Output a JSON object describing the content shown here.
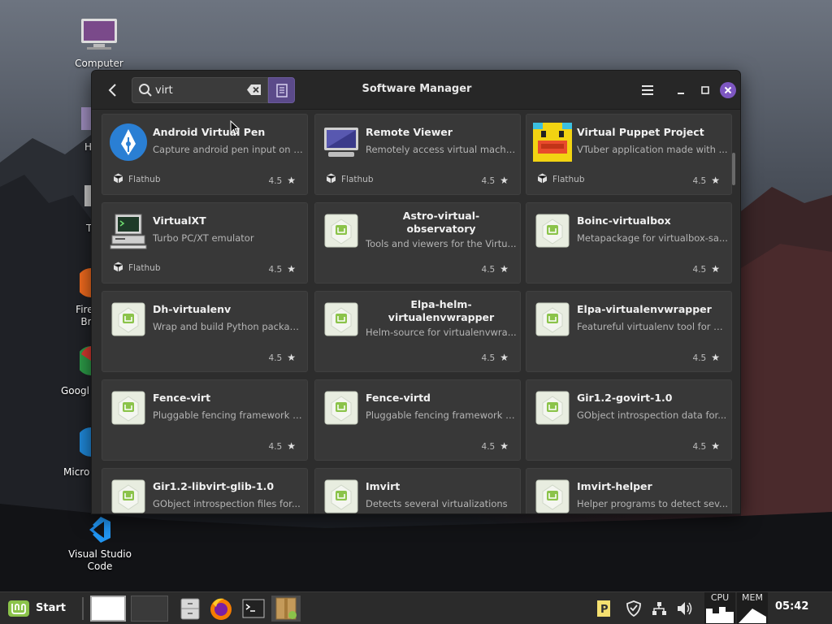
{
  "desktop": {
    "icons": [
      {
        "label": "Computer"
      },
      {
        "label": "H"
      },
      {
        "label": "T"
      },
      {
        "label": "Firef\nBr"
      },
      {
        "label": "Googl"
      },
      {
        "label": "Micro"
      },
      {
        "label": "Visual Studio Code"
      }
    ]
  },
  "window": {
    "title": "Software Manager",
    "search": {
      "value": "virt",
      "placeholder": ""
    }
  },
  "apps": [
    {
      "name": "Android Virtual Pen",
      "desc": "Capture android pen input on L...",
      "source": "Flathub",
      "rating": "4.5",
      "icon": "pen-nib-icon"
    },
    {
      "name": "Remote Viewer",
      "desc": "Remotely access virtual machines",
      "source": "Flathub",
      "rating": "4.5",
      "icon": "monitor-icon"
    },
    {
      "name": "Virtual Puppet Project",
      "desc": "VTuber application made with ...",
      "source": "Flathub",
      "rating": "4.5",
      "icon": "puppet-duck-icon"
    },
    {
      "name": "VirtualXT",
      "desc": "Turbo PC/XT emulator",
      "source": "Flathub",
      "rating": "4.5",
      "icon": "retro-pc-icon"
    },
    {
      "name": "Astro-virtual-observatory",
      "desc": "Tools and viewers for the Virtu...",
      "source": "",
      "rating": "4.5",
      "icon": "mint-package-icon"
    },
    {
      "name": "Boinc-virtualbox",
      "desc": "Metapackage for virtualbox-sa...",
      "source": "",
      "rating": "4.5",
      "icon": "mint-package-icon"
    },
    {
      "name": "Dh-virtualenv",
      "desc": "Wrap and build Python package...",
      "source": "",
      "rating": "4.5",
      "icon": "mint-package-icon"
    },
    {
      "name": "Elpa-helm-virtualenvwrapper",
      "desc": "Helm-source for virtualenvwra...",
      "source": "",
      "rating": "4.5",
      "icon": "mint-package-icon"
    },
    {
      "name": "Elpa-virtualenvwrapper",
      "desc": "Featureful virtualenv tool for E...",
      "source": "",
      "rating": "4.5",
      "icon": "mint-package-icon"
    },
    {
      "name": "Fence-virt",
      "desc": "Pluggable fencing framework f...",
      "source": "",
      "rating": "4.5",
      "icon": "mint-package-icon"
    },
    {
      "name": "Fence-virtd",
      "desc": "Pluggable fencing framework f...",
      "source": "",
      "rating": "4.5",
      "icon": "mint-package-icon"
    },
    {
      "name": "Gir1.2-govirt-1.0",
      "desc": "GObject introspection data for...",
      "source": "",
      "rating": "4.5",
      "icon": "mint-package-icon"
    },
    {
      "name": "Gir1.2-libvirt-glib-1.0",
      "desc": "GObject introspection files for...",
      "source": "",
      "rating": "4.5",
      "icon": "mint-package-icon"
    },
    {
      "name": "Imvirt",
      "desc": "Detects several virtualizations",
      "source": "",
      "rating": "4.5",
      "icon": "mint-package-icon"
    },
    {
      "name": "Imvirt-helper",
      "desc": "Helper programs to detect sev...",
      "source": "",
      "rating": "4.5",
      "icon": "mint-package-icon"
    }
  ],
  "taskbar": {
    "start_label": "Start",
    "cpu_label": "CPU",
    "mem_label": "MEM",
    "clock": "05:42"
  }
}
